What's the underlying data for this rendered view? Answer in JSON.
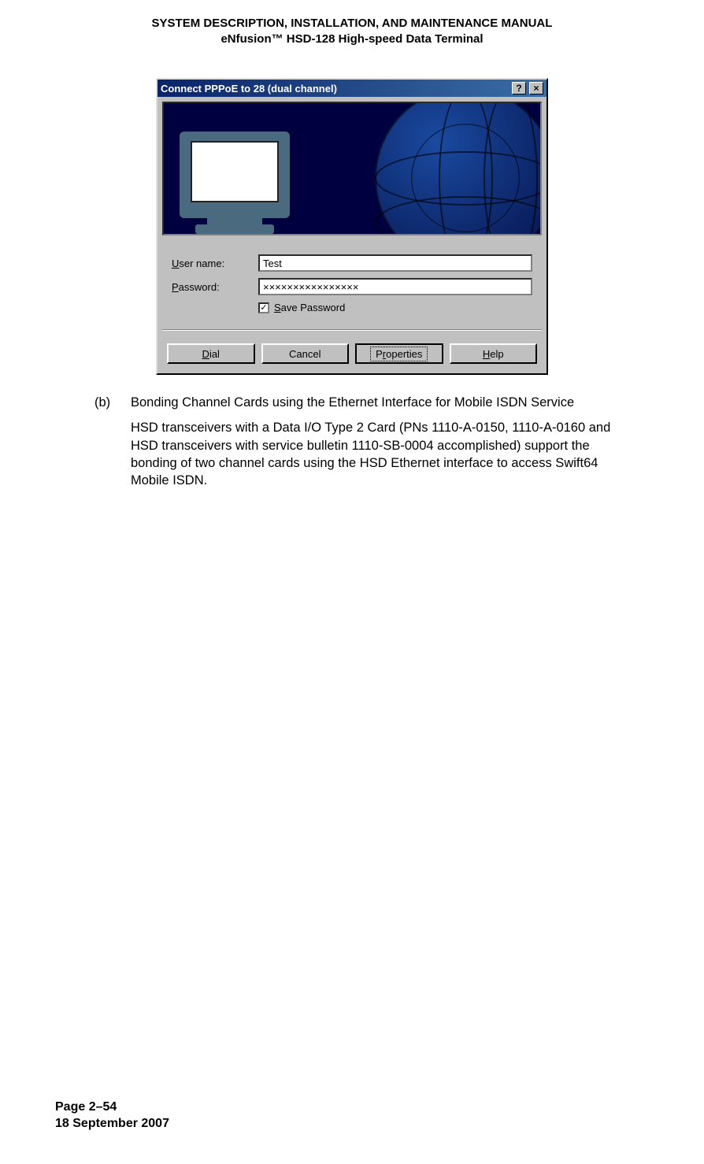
{
  "header": {
    "line1": "SYSTEM DESCRIPTION, INSTALLATION, AND MAINTENANCE MANUAL",
    "line2": "eNfusion™ HSD-128 High-speed Data Terminal"
  },
  "dialog": {
    "title": "Connect PPPoE to 28 (dual channel)",
    "help_btn": "?",
    "close_btn": "×",
    "username_label": "User name:",
    "username_u": "U",
    "username_value": "Test",
    "password_label": "Password:",
    "password_u": "P",
    "password_value": "××××××××××××××××",
    "save_label": "Save Password",
    "save_u": "S",
    "save_checked": "✓",
    "buttons": {
      "dial": "Dial",
      "dial_u": "D",
      "cancel": "Cancel",
      "properties": "Properties",
      "properties_u": "r",
      "help": "Help",
      "help_u": "H"
    }
  },
  "section": {
    "label": "(b)",
    "title": "Bonding Channel Cards using the Ethernet Interface for Mobile ISDN Service",
    "para": "HSD transceivers with a Data I/O Type 2 Card (PNs 1110-A-0150, 1110-A-0160 and HSD transceivers with service bulletin 1110-SB-0004 accomplished) support the bonding of two channel cards using the HSD Ethernet interface to access Swift64 Mobile ISDN."
  },
  "footer": {
    "page": "Page 2–54",
    "date": "18 September 2007"
  }
}
